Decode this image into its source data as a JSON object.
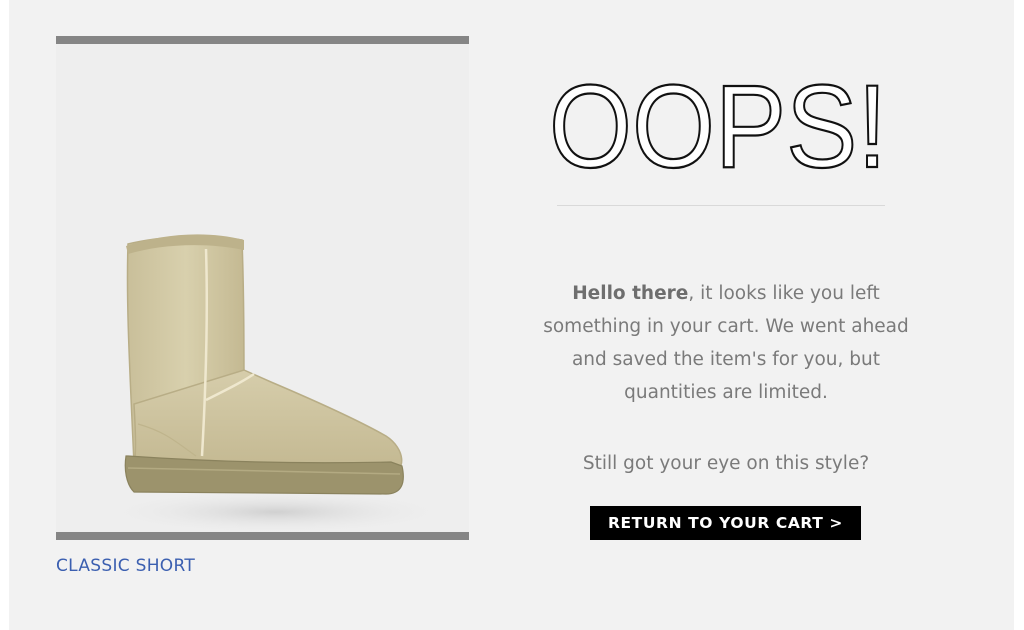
{
  "product": {
    "name": "CLASSIC SHORT",
    "image_icon": "boot-image",
    "colors": {
      "frame_bar": "#858585",
      "link": "#3b5fb0"
    }
  },
  "headline": "OOPS!",
  "message": {
    "greeting": "Hello there",
    "body": ", it looks like you left something in your cart. We went ahead and saved the item's for you, but quantities are limited.",
    "question": "Still got your eye on this style?"
  },
  "cta": {
    "label": "RETURN TO YOUR CART >",
    "background": "#000000",
    "text_color": "#ffffff"
  }
}
